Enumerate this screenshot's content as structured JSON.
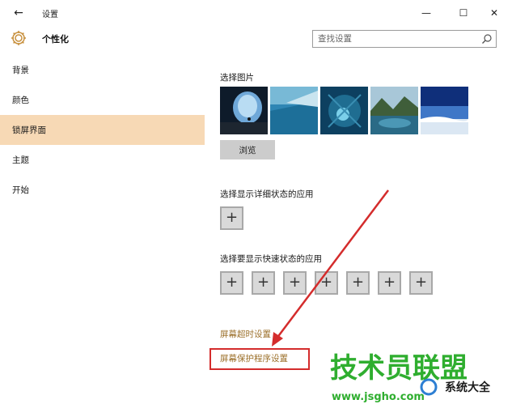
{
  "window": {
    "title": "设置",
    "back_icon": "←",
    "minimize_icon": "—",
    "maximize_icon": "☐",
    "close_icon": "✕"
  },
  "header": {
    "title": "个性化",
    "search_placeholder": "查找设置"
  },
  "sidebar": {
    "items": [
      {
        "label": "背景",
        "active": false
      },
      {
        "label": "颜色",
        "active": false
      },
      {
        "label": "锁屏界面",
        "active": true
      },
      {
        "label": "主题",
        "active": false
      },
      {
        "label": "开始",
        "active": false
      }
    ]
  },
  "main": {
    "choose_picture_label": "选择图片",
    "browse_label": "浏览",
    "detailed_status_label": "选择显示详细状态的应用",
    "quick_status_label": "选择要显示快速状态的应用",
    "plus_symbol": "+",
    "screen_timeout_link": "屏幕超时设置",
    "screensaver_link": "屏幕保护程序设置"
  },
  "watermark": {
    "text_large": "技术员联盟",
    "text_small": "系统大全",
    "url": "www.jsgho.com"
  },
  "colors": {
    "active_item_bg": "#f7d9b5",
    "link_color": "#9b6f29",
    "highlight_red": "#d42c2c"
  }
}
